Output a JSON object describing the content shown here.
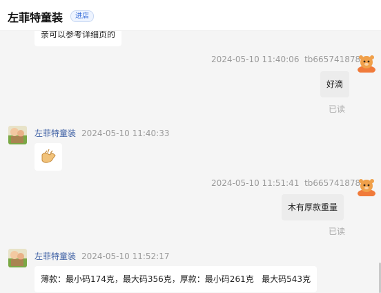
{
  "header": {
    "shop_name": "左菲特童装",
    "enter_store_label": "进店"
  },
  "messages": [
    {
      "type": "shop",
      "text": "亲可以参考详细页的"
    },
    {
      "type": "user",
      "time": "2024-05-10 11:40:06",
      "user": "tb665741878",
      "text": "好滴",
      "status": "已读"
    },
    {
      "type": "shop",
      "name": "左菲特童装",
      "time": "2024-05-10 11:40:33",
      "emoji": "handshake-emoji"
    },
    {
      "type": "user",
      "time": "2024-05-10 11:51:41",
      "user": "tb665741878",
      "text": "木有厚款重量",
      "status": "已读"
    },
    {
      "type": "shop",
      "name": "左菲特童装",
      "time": "2024-05-10 11:52:17",
      "text": "薄款：最小码174克，最大码356克，厚款：最小码261克   最大码543克"
    }
  ],
  "colors": {
    "name_link": "#3c5ea3",
    "enter_store": "#3a6fd8",
    "meta_text": "#9a9a9a",
    "user_bubble": "#ececec"
  }
}
